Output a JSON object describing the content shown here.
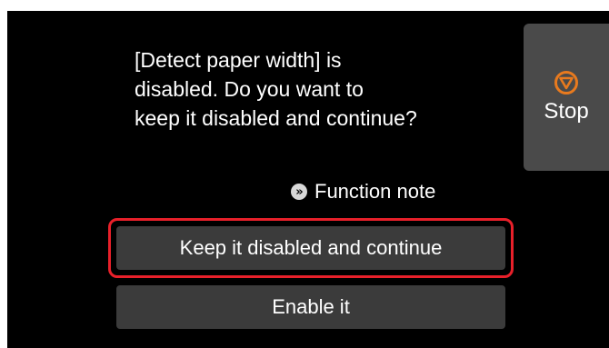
{
  "message": {
    "lines": [
      "[Detect paper width] is",
      "disabled. Do you want to",
      "keep it disabled and continue?"
    ]
  },
  "stop_button": {
    "label": "Stop",
    "icon": "stop-icon",
    "color": "#e87a1e"
  },
  "function_note": {
    "label": "Function note",
    "icon": "double-chevron-right-icon"
  },
  "buttons": {
    "keep": "Keep it disabled and continue",
    "enable": "Enable it"
  },
  "highlight_color": "#e8202a"
}
